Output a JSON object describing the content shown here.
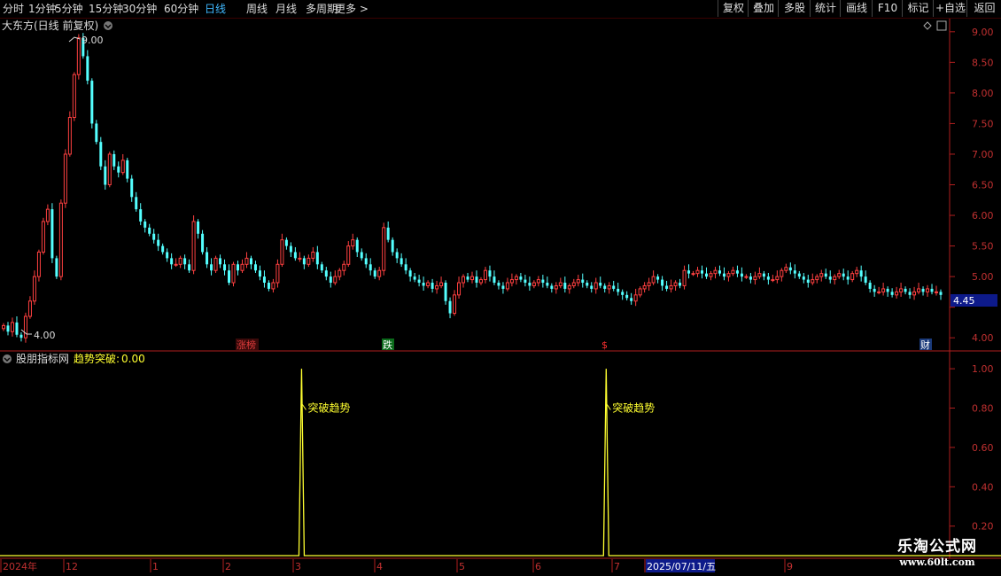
{
  "toolbar": {
    "periods": [
      "分时",
      "1分钟",
      "5分钟",
      "15分钟",
      "30分钟",
      "60分钟",
      "日线",
      "周线",
      "月线",
      "多周期",
      "更多 >"
    ],
    "active_period": "日线",
    "buttons": [
      "复权",
      "叠加",
      "多股",
      "统计",
      "画线",
      "F10",
      "标记",
      "+自选",
      "返回"
    ]
  },
  "main_panel": {
    "title": "大东方(日线 前复权)",
    "high_marker": "9.00",
    "low_marker": "4.00",
    "last_price": "4.45",
    "events": [
      {
        "label": "涨榜",
        "color": "#e03c3c",
        "bg": "#3a0a0a"
      },
      {
        "label": "跌",
        "color": "#ffffff",
        "bg": "#0a6a1a"
      },
      {
        "label": "$",
        "color": "#ff3030",
        "bg": "#000000"
      },
      {
        "label": "财",
        "color": "#ffffff",
        "bg": "#1a3a7a"
      }
    ]
  },
  "indicator_panel": {
    "name": "股朋指标网",
    "series_label": "趋势突破",
    "series_value": "0.00",
    "signal_text": "突破趋势"
  },
  "date_axis": {
    "labels": [
      "2024年",
      "12",
      "1",
      "2",
      "3",
      "4",
      "5",
      "6",
      "7",
      "2025/07/11/五",
      "9"
    ],
    "highlight": "2025/07/11/五"
  },
  "watermark": {
    "line1": "乐淘公式网",
    "line2": "www.60lt.com"
  },
  "colors": {
    "up": "#ff4040",
    "down": "#54ffff",
    "axis": "#b01e1e",
    "indicator": "#ffff30",
    "bg": "#000000"
  },
  "chart_data": [
    {
      "type": "candlestick",
      "title": "大东方(日线 前复权)",
      "ylim": [
        3.8,
        9.2
      ],
      "yticks": [
        4.0,
        4.5,
        5.0,
        5.5,
        6.0,
        6.5,
        7.0,
        7.5,
        8.0,
        8.5,
        9.0
      ],
      "ytick_labels": [
        "4.00",
        "",
        "5.00",
        "5.50",
        "6.00",
        "6.50",
        "7.00",
        "7.50",
        "8.00",
        "8.50",
        "9.00"
      ],
      "close": [
        4.2,
        4.1,
        4.25,
        4.05,
        4.0,
        4.35,
        4.6,
        5.0,
        5.4,
        5.9,
        6.1,
        5.3,
        5.0,
        6.2,
        7.0,
        7.6,
        8.3,
        8.9,
        8.6,
        8.2,
        7.5,
        7.2,
        6.8,
        6.5,
        7.0,
        6.8,
        6.7,
        6.9,
        6.6,
        6.3,
        6.1,
        5.9,
        5.8,
        5.7,
        5.6,
        5.5,
        5.4,
        5.3,
        5.2,
        5.2,
        5.3,
        5.2,
        5.1,
        5.9,
        5.7,
        5.4,
        5.2,
        5.1,
        5.3,
        5.2,
        5.1,
        4.9,
        5.2,
        5.1,
        5.2,
        5.3,
        5.2,
        5.1,
        5.0,
        4.9,
        4.8,
        4.9,
        5.2,
        5.6,
        5.5,
        5.4,
        5.3,
        5.3,
        5.2,
        5.3,
        5.4,
        5.2,
        5.1,
        5.0,
        4.9,
        5.0,
        5.1,
        5.2,
        5.5,
        5.6,
        5.4,
        5.3,
        5.2,
        5.1,
        5.0,
        5.1,
        5.8,
        5.6,
        5.4,
        5.3,
        5.2,
        5.1,
        5.0,
        4.95,
        4.9,
        4.85,
        4.9,
        4.8,
        4.85,
        4.9,
        4.6,
        4.4,
        4.7,
        4.9,
        5.0,
        4.95,
        5.0,
        4.9,
        4.95,
        5.1,
        5.0,
        4.9,
        4.85,
        4.8,
        4.9,
        4.95,
        5.0,
        4.95,
        4.9,
        4.85,
        4.9,
        4.95,
        4.9,
        4.85,
        4.8,
        4.85,
        4.9,
        4.8,
        4.85,
        4.9,
        4.95,
        4.9,
        4.85,
        4.8,
        4.9,
        4.85,
        4.8,
        4.85,
        4.8,
        4.75,
        4.7,
        4.65,
        4.6,
        4.7,
        4.8,
        4.85,
        4.9,
        5.0,
        4.95,
        4.85,
        4.8,
        4.85,
        4.9,
        4.85,
        5.1,
        5.05,
        5.05,
        5.1,
        5.05,
        5.0,
        5.05,
        5.1,
        5.05,
        5.0,
        5.05,
        5.1,
        5.05,
        5.0,
        5.0,
        4.95,
        5.0,
        5.05,
        5.0,
        4.95,
        4.95,
        5.0,
        5.1,
        5.15,
        5.1,
        5.05,
        5.0,
        4.95,
        4.9,
        4.95,
        5.0,
        5.05,
        5.0,
        4.95,
        5.0,
        5.05,
        5.0,
        4.95,
        5.05,
        5.1,
        5.0,
        4.9,
        4.8,
        4.75,
        4.75,
        4.8,
        4.75,
        4.7,
        4.75,
        4.8,
        4.75,
        4.7,
        4.75,
        4.8,
        4.75,
        4.8,
        4.75,
        4.75,
        4.7
      ]
    },
    {
      "type": "line",
      "name": "趋势突破",
      "ylim": [
        0.05,
        1.05
      ],
      "yticks": [
        0.2,
        0.4,
        0.6,
        0.8,
        1.0
      ],
      "ytick_labels": [
        "0.20",
        "0.40",
        "0.60",
        "0.80",
        "1.00"
      ],
      "baseline": 0.0,
      "spikes": [
        {
          "position": 0.318,
          "value": 1.0
        },
        {
          "position": 0.643,
          "value": 1.0
        }
      ]
    }
  ]
}
